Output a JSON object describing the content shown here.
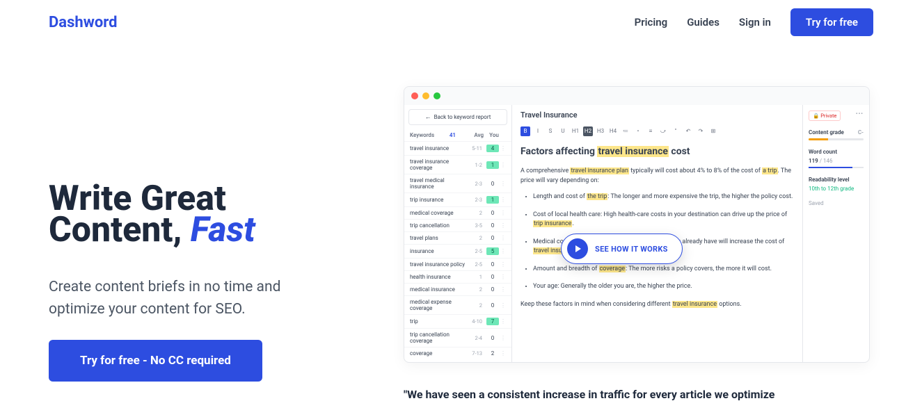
{
  "nav": {
    "logo": "Dashword",
    "links": [
      "Pricing",
      "Guides",
      "Sign in"
    ],
    "cta": "Try for free"
  },
  "hero": {
    "title_line1": "Write Great",
    "title_line2a": "Content, ",
    "title_line2b": "Fast",
    "subtitle": "Create content briefs in no time and optimize your content for SEO.",
    "cta": "Try for free - No CC required"
  },
  "mock": {
    "back": "Back to keyword report",
    "sidebar": {
      "label": "Keywords",
      "count": "41",
      "col_avg": "Avg",
      "col_you": "You",
      "rows": [
        {
          "name": "travel insurance",
          "avg": "5-11",
          "you": "4",
          "hi": true
        },
        {
          "name": "travel insurance coverage",
          "avg": "1-2",
          "you": "1",
          "hi": true
        },
        {
          "name": "travel medical insurance",
          "avg": "2-3",
          "you": "0"
        },
        {
          "name": "trip insurance",
          "avg": "2-3",
          "you": "1",
          "hi": true
        },
        {
          "name": "medical coverage",
          "avg": "2",
          "you": "0"
        },
        {
          "name": "trip cancellation",
          "avg": "3-5",
          "you": "0"
        },
        {
          "name": "travel plans",
          "avg": "2",
          "you": "0"
        },
        {
          "name": "insurance",
          "avg": "2-5",
          "you": "5",
          "hi": true
        },
        {
          "name": "travel insurance policy",
          "avg": "2-5",
          "you": "0"
        },
        {
          "name": "health insurance",
          "avg": "1",
          "you": "0"
        },
        {
          "name": "medical insurance",
          "avg": "2",
          "you": "0"
        },
        {
          "name": "medical expense coverage",
          "avg": "2",
          "you": "0"
        },
        {
          "name": "trip",
          "avg": "4-10",
          "you": "7",
          "hi": true
        },
        {
          "name": "trip cancellation coverage",
          "avg": "2-4",
          "you": "0"
        },
        {
          "name": "coverage",
          "avg": "7-13",
          "you": "2"
        }
      ]
    },
    "editor": {
      "title": "Travel Insurance",
      "toolbar": [
        "B",
        "I",
        "S",
        "U",
        "H1",
        "H2",
        "H3",
        "H4",
        "≔",
        "•",
        "≡",
        "⤻",
        "\"",
        "↶",
        "↷",
        "⊞"
      ],
      "h2_a": "Factors affecting ",
      "h2_hl": "travel insurance",
      "h2_b": " cost",
      "p1_a": "A comprehensive ",
      "p1_hl": "travel insurance plan",
      "p1_b": " typically will cost about 4% to 8% of the cost of ",
      "p1_hl2": "a trip",
      "p1_c": ". The price will vary depending on:",
      "li1_a": "Length and cost of ",
      "li1_hl": "the trip",
      "li1_b": ": The longer and more expensive the trip, the higher the policy cost.",
      "li2_a": "Cost of local health care: High health-care costs in your destination can drive up the price of ",
      "li2_hl": "trip insurance",
      "li2_b": ".",
      "li3_a": "Medical conditions you want covered: Conditions you already have will increase the cost of ",
      "li3_hl": "travel insurance coverage",
      "li3_b": ".",
      "li4_a": "Amount and breadth of ",
      "li4_hl": "coverage",
      "li4_b": ": The more risks a policy covers, the more it will cost.",
      "li5": "Your age: Generally the older you are, the higher the price.",
      "p2_a": "Keep these factors in mind when considering different ",
      "p2_hl": "travel insurance",
      "p2_b": " options."
    },
    "meta": {
      "private": "🔒 Private",
      "grade_label": "Content grade",
      "grade_val": "C-",
      "wc_label": "Word count",
      "wc": "119",
      "wc_target": " / 146",
      "read_label": "Readability level",
      "read_val": "10th to 12th grade",
      "saved": "Saved"
    },
    "how": "SEE HOW IT WORKS"
  },
  "testimonial": "\"We have seen a consistent increase in traffic for every article we optimize"
}
